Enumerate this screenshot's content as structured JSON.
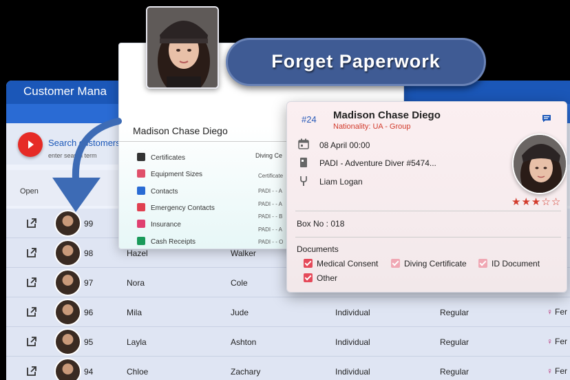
{
  "headline": "Forget Paperwork",
  "app": {
    "title": "Customer Mana",
    "search_label": "Search customers",
    "search_hint": "enter search term",
    "col_open": "Open"
  },
  "rows": [
    {
      "num": "99",
      "first": "",
      "last": "",
      "type": "",
      "category": "",
      "gender": ""
    },
    {
      "num": "98",
      "first": "Hazel",
      "last": "Walker",
      "type": "",
      "category": "",
      "gender": ""
    },
    {
      "num": "97",
      "first": "Nora",
      "last": "Cole",
      "type": "",
      "category": "",
      "gender": ""
    },
    {
      "num": "96",
      "first": "Mila",
      "last": "Jude",
      "type": "Individual",
      "category": "Regular",
      "gender": "Fer"
    },
    {
      "num": "95",
      "first": "Layla",
      "last": "Ashton",
      "type": "Individual",
      "category": "Regular",
      "gender": "Fer"
    },
    {
      "num": "94",
      "first": "Chloe",
      "last": "Zachary",
      "type": "Individual",
      "category": "Regular",
      "gender": "Fer"
    }
  ],
  "panel": {
    "name": "Madison Chase Diego",
    "menu": [
      {
        "label": "Certificates",
        "icon": "certificate-icon",
        "color": "#333333"
      },
      {
        "label": "Equipment Sizes",
        "icon": "ruler-icon",
        "color": "#e0506a"
      },
      {
        "label": "Contacts",
        "icon": "contacts-icon",
        "color": "#2a6bd4"
      },
      {
        "label": "Emergency Contacts",
        "icon": "medical-cross-icon",
        "color": "#e04050"
      },
      {
        "label": "Insurance",
        "icon": "shield-icon",
        "color": "#e04070"
      },
      {
        "label": "Cash Receipts",
        "icon": "euro-icon",
        "color": "#1a9a5a"
      }
    ],
    "diving": "Diving Ce",
    "cert_header": "Certificate",
    "padi_lines": [
      "PADI - - A",
      "PADI - - A",
      "PADI - - B",
      "PADI - - A",
      "PADI - - O"
    ]
  },
  "card": {
    "id": "#24",
    "name": "Madison Chase Diego",
    "nationality": "Nationality: UA - Group",
    "date": "08 April 00:00",
    "certificate": "PADI - Adventure Diver #5474...",
    "instructor": "Liam Logan",
    "rating": 3,
    "rating_max": 5,
    "box_no": "Box No : 018",
    "documents_title": "Documents",
    "documents": [
      {
        "label": "Medical Consent",
        "checked": true
      },
      {
        "label": "Diving Certificate",
        "checked": false
      },
      {
        "label": "ID Document",
        "checked": false
      },
      {
        "label": "Other",
        "checked": true
      }
    ]
  }
}
